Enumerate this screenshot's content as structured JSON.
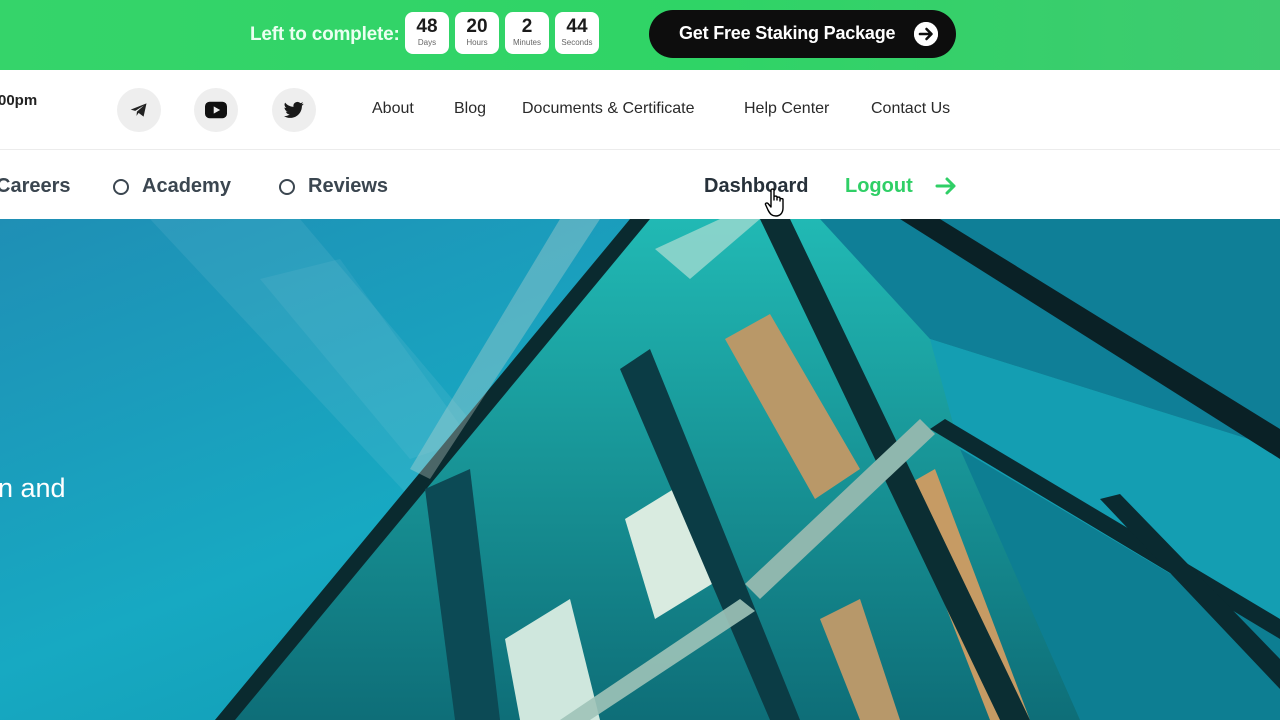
{
  "promo": {
    "label": "Left to complete:",
    "countdown": [
      {
        "value": "48",
        "unit": "Days"
      },
      {
        "value": "20",
        "unit": "Hours"
      },
      {
        "value": "2",
        "unit": "Minutes"
      },
      {
        "value": "44",
        "unit": "Seconds"
      }
    ],
    "cta_label": "Get Free Staking Package",
    "cta_icon": "arrow-circle-right-icon"
  },
  "util": {
    "time_fragment": "00pm",
    "social": [
      {
        "name": "telegram-icon"
      },
      {
        "name": "youtube-icon"
      },
      {
        "name": "twitter-icon"
      }
    ],
    "links": [
      "About",
      "Blog",
      "Documents & Certificate",
      "Help Center",
      "Contact Us"
    ]
  },
  "nav": {
    "items": [
      "Careers",
      "Academy",
      "Reviews"
    ],
    "dashboard": "Dashboard",
    "logout": "Logout"
  },
  "hero": {
    "text_fragment": "n and"
  },
  "colors": {
    "accent": "#2fcf66",
    "dark": "#0d0d0d"
  }
}
